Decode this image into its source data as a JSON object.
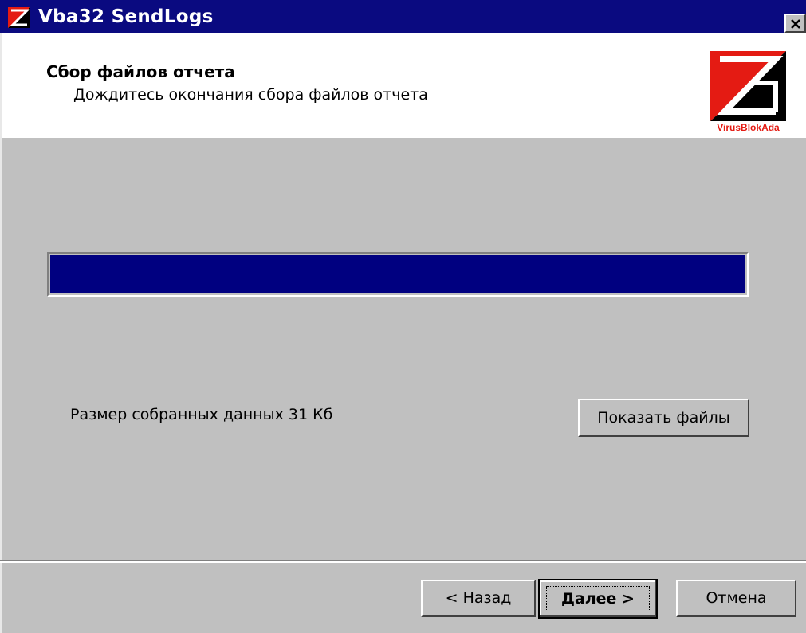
{
  "window": {
    "title": "Vba32 SendLogs",
    "app_icon": "vba32-logo-icon",
    "close_icon": "close-icon"
  },
  "header": {
    "title": "Сбор файлов отчета",
    "subtitle": "Дождитесь окончания сбора файлов отчета",
    "logo_text": "VirusBlokAda",
    "logo_colors": {
      "red": "#e41b13",
      "black": "#000000"
    }
  },
  "progress": {
    "value_percent": 100,
    "fill_color": "#000080"
  },
  "info": {
    "data_size_text": "Размер собранных данных 31 Кб"
  },
  "buttons": {
    "show_files": "Показать файлы",
    "back": "< Назад",
    "next": "Далее >",
    "cancel": "Отмена"
  },
  "colors": {
    "titlebar": "#0a0a80",
    "dialog_bg": "#c0c0c0",
    "header_bg": "#ffffff"
  }
}
